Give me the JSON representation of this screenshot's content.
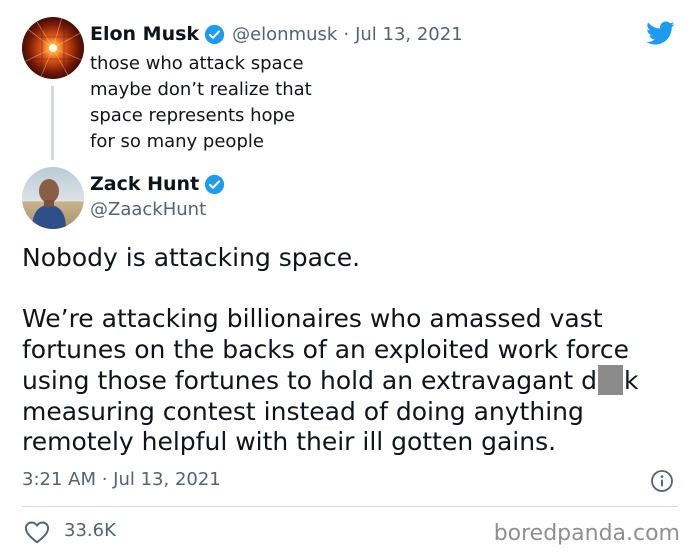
{
  "parent_tweet": {
    "author_name": "Elon Musk",
    "handle": "@elonmusk",
    "date_sep": "·",
    "date": "Jul 13, 2021",
    "text_lines": [
      "those who attack space",
      "maybe don’t realize that",
      "space represents hope",
      "for so many people"
    ]
  },
  "main_tweet": {
    "author_name": "Zack Hunt",
    "handle": "@ZaackHunt",
    "paragraph_1": "Nobody is attacking space.",
    "paragraph_2_lines": [
      "We’re attacking billionaires who amassed vast",
      "fortunes on the backs of an exploited work force",
      "using those fortunes to hold an extravagant d",
      "k",
      "measuring contest instead of doing anything",
      "remotely helpful with their ill gotten gains."
    ],
    "timestamp": "3:21 AM · Jul 13, 2021",
    "like_count": "33.6K"
  },
  "icons": {
    "brand": "twitter-bird-icon",
    "verified": "verified-badge-icon",
    "info": "info-icon",
    "like": "heart-icon"
  },
  "colors": {
    "twitter_blue": "#1d9bf0",
    "text_primary": "#0f1419",
    "text_secondary": "#536471",
    "divider": "#cfd9de"
  },
  "watermark": "boredpanda.com"
}
